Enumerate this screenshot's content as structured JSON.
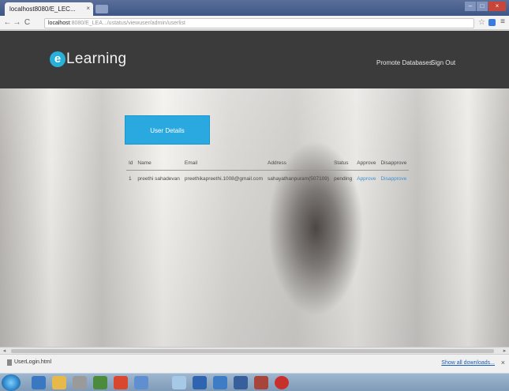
{
  "browser": {
    "tab_title": "localhost8080/E_LEC...",
    "tab_close": "×",
    "url_host": "localhost",
    "url_path": ":8080/E_LEA.../ustatus/viewuser/admin/userlist",
    "back": "←",
    "forward": "→",
    "reload": "C",
    "star": "☆",
    "menu": "≡"
  },
  "site": {
    "logo_badge": "e",
    "logo_text": "Learning",
    "nav": [
      "Promote Databases",
      "Sign Out"
    ]
  },
  "main": {
    "button_label": "User Details",
    "table": {
      "headers": [
        "Id",
        "Name",
        "Email",
        "Address",
        "Status",
        "Approve",
        "Disapprove"
      ],
      "rows": [
        [
          "1",
          "preethi sahadevan",
          "preethikapreethi.1008@gmail.com",
          "sahayathanpuram(507109)",
          "pending",
          "Approve",
          "Disapprove"
        ]
      ]
    }
  },
  "downloads": {
    "item": "UserLogin.html",
    "show_all": "Show all downloads...",
    "close": "×"
  },
  "colors": {
    "accent": "#29a9e0",
    "navbar": "#3b3b3b",
    "link": "#3f8fd0"
  }
}
